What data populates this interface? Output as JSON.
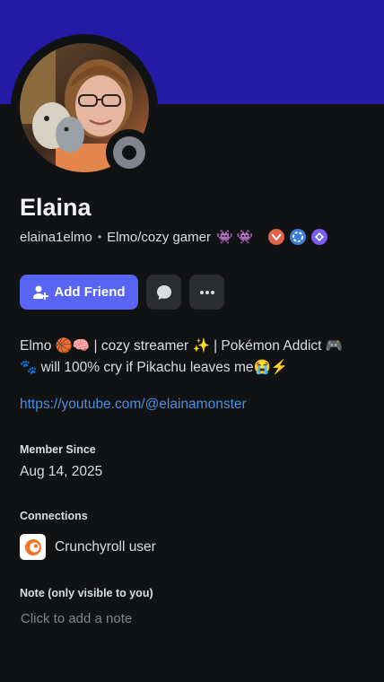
{
  "profile": {
    "display_name": "Elaina",
    "username": "elaina1elmo",
    "separator": "•",
    "custom_status": "Elmo/cozy gamer",
    "status_emoji": "👾 👾"
  },
  "actions": {
    "add_friend_label": "Add Friend"
  },
  "bio": {
    "line1": "Elmo 🏀🧠 | cozy streamer ✨ | Pokémon Addict 🎮",
    "line2": "🐾 will 100% cry if Pikachu leaves me😭⚡"
  },
  "link": "https://youtube.com/@elainamonster",
  "member_since": {
    "title": "Member Since",
    "value": "Aug 14, 2025"
  },
  "connections": {
    "title": "Connections",
    "items": [
      {
        "name": "Crunchyroll user",
        "icon": "crunchyroll-icon"
      }
    ]
  },
  "note": {
    "title": "Note (only visible to you)",
    "placeholder": "Click to add a note"
  },
  "colors": {
    "banner": "#231aa6",
    "background": "#111214",
    "accent": "#5865f2",
    "link": "#4a90e2",
    "status_offline": "#80848e"
  }
}
